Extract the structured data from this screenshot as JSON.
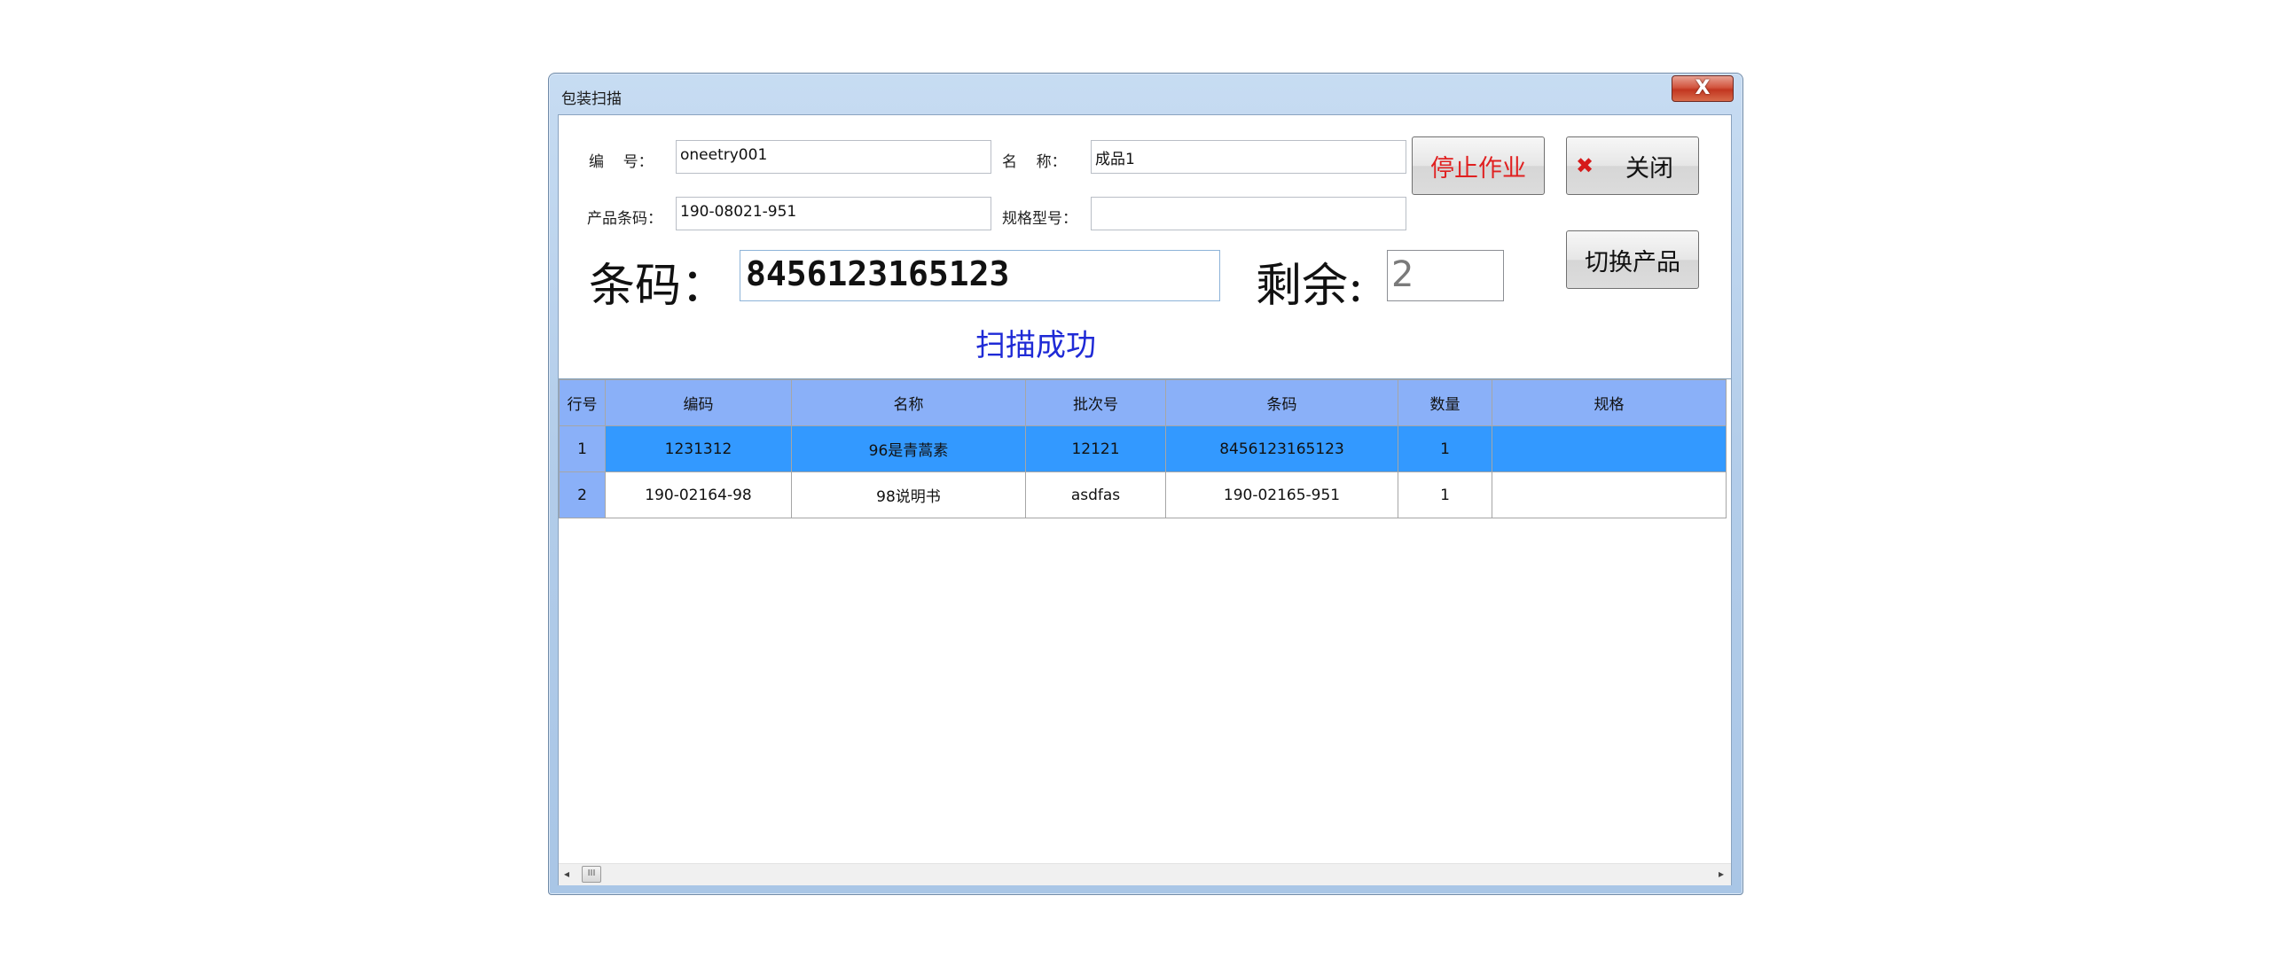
{
  "window": {
    "title": "包装扫描",
    "close_glyph": "X"
  },
  "form": {
    "code_label": "编    号：",
    "code_value": "oneetry001",
    "name_label": "名    称：",
    "name_value": "成品1",
    "barcode_label": "产品条码：",
    "barcode_value": "190-08021-951",
    "spec_label": "规格型号：",
    "spec_value": ""
  },
  "scan": {
    "barcode_label": "条码：",
    "barcode_value": "8456123165123",
    "remain_label": "剩余:",
    "remain_value": "2",
    "status": "扫描成功"
  },
  "buttons": {
    "stop": "停止作业",
    "close": "关闭",
    "switch": "切换产品"
  },
  "colors": {
    "stop_text": "#e02020",
    "status_text": "#1f2ad6",
    "header_bg": "#8ab0f8",
    "selected_row": "#3399ff"
  },
  "table": {
    "headers": [
      "行号",
      "编码",
      "名称",
      "批次号",
      "条码",
      "数量",
      "规格"
    ],
    "rows": [
      [
        "1",
        "1231312",
        "96是青蒿素",
        "12121",
        "8456123165123",
        "1",
        ""
      ],
      [
        "2",
        "190-02164-98",
        "98说明书",
        "asdfas",
        "190-02165-951",
        "1",
        ""
      ]
    ]
  },
  "scrollbar": {
    "left_arrow": "◂",
    "right_arrow": "▸",
    "thumb_grip": "III"
  }
}
